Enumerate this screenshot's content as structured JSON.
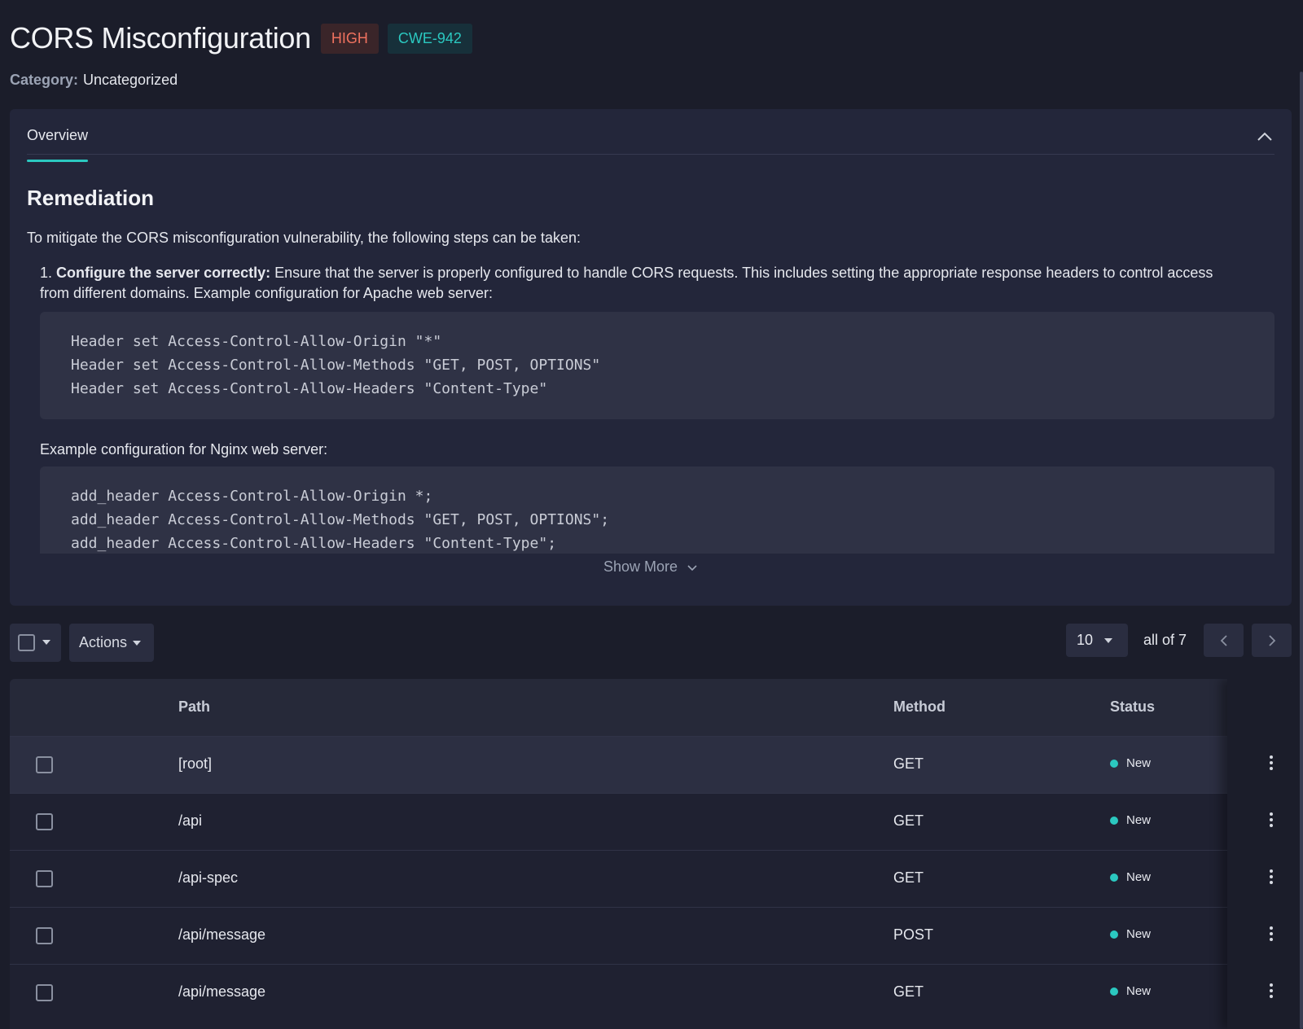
{
  "header": {
    "title": "CORS Misconfiguration",
    "severity": "HIGH",
    "cwe": "CWE-942",
    "category_label": "Category:",
    "category_value": "Uncategorized"
  },
  "tabs": [
    {
      "label": "Overview",
      "active": true
    }
  ],
  "overview": {
    "heading": "Remediation",
    "intro": "To mitigate the CORS misconfiguration vulnerability, the following steps can be taken:",
    "step1_number": "1.",
    "step1_title": "Configure the server correctly:",
    "step1_text": " Ensure that the server is properly configured to handle CORS requests. This includes setting the appropriate response headers to control access from different domains. Example configuration for Apache web server:",
    "apache_code": [
      "Header set Access-Control-Allow-Origin \"*\"",
      "Header set Access-Control-Allow-Methods \"GET, POST, OPTIONS\"",
      "Header set Access-Control-Allow-Headers \"Content-Type\""
    ],
    "nginx_label": "Example configuration for Nginx web server:",
    "nginx_code": [
      "add_header Access-Control-Allow-Origin *;",
      "add_header Access-Control-Allow-Methods \"GET, POST, OPTIONS\";",
      "add_header Access-Control-Allow-Headers \"Content-Type\";"
    ],
    "show_more": "Show More"
  },
  "toolbar": {
    "actions_label": "Actions",
    "per_page": "10",
    "count_text": "all of 7"
  },
  "table": {
    "columns": {
      "path": "Path",
      "method": "Method",
      "status": "Status"
    },
    "rows": [
      {
        "path": "[root]",
        "method": "GET",
        "status": "New"
      },
      {
        "path": "/api",
        "method": "GET",
        "status": "New"
      },
      {
        "path": "/api-spec",
        "method": "GET",
        "status": "New"
      },
      {
        "path": "/api/message",
        "method": "POST",
        "status": "New"
      },
      {
        "path": "/api/message",
        "method": "GET",
        "status": "New"
      }
    ]
  },
  "colors": {
    "accent": "#2bc8c0",
    "severity_high": "#f0725f",
    "background": "#1b1d2a"
  },
  "icons": {
    "collapse": "chevron-up-icon",
    "show_more": "chevron-down-icon",
    "prev": "chevron-left-icon",
    "next": "chevron-right-icon",
    "row_menu": "kebab-menu-icon",
    "status": "status-dot-icon"
  }
}
